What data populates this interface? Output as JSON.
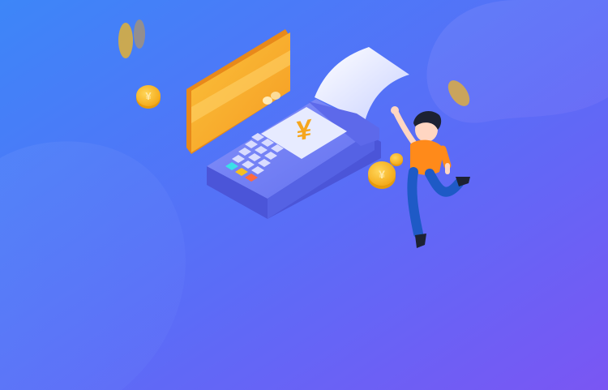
{
  "illustration": {
    "subject": "",
    "currency_symbol": "¥",
    "coin_symbol": "¥",
    "colors": {
      "bg_start": "#3d86f8",
      "bg_mid": "#5b6cf7",
      "bg_end": "#7a56f3",
      "card_front": "#f7a928",
      "card_side": "#e8891a",
      "terminal": "#6f7ff5",
      "terminal_dark": "#4b55d8",
      "screen": "#e7ebff",
      "receipt": "#f2f5ff",
      "coin": "#f6b81b",
      "coin_dark": "#e59a0c",
      "shirt": "#ff8a1a",
      "pants": "#1e5ac6",
      "hair": "#1d2233",
      "skin": "#ffd6c2"
    },
    "icons": [
      "coin-icon",
      "credit-card-icon",
      "pos-terminal-icon",
      "receipt-icon",
      "person-icon"
    ]
  }
}
